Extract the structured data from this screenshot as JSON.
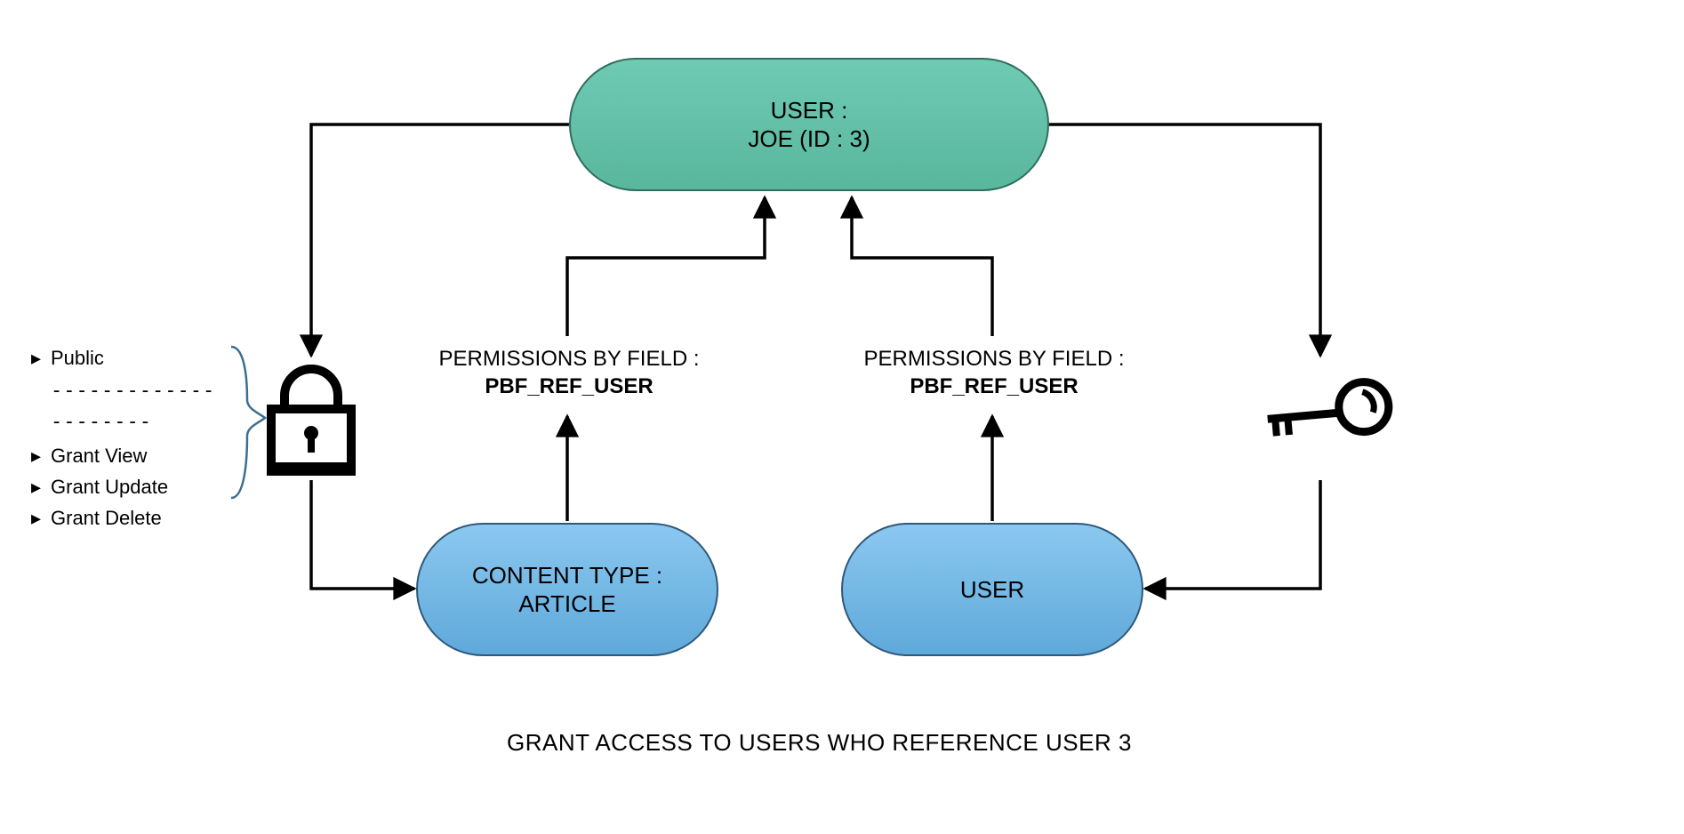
{
  "nodes": {
    "user_top": {
      "line1": "USER :",
      "line2": "JOE (ID : 3)"
    },
    "content_type": {
      "line1": "CONTENT TYPE :",
      "line2": "ARTICLE"
    },
    "user_bottom": {
      "label": "USER"
    }
  },
  "edges": {
    "perm_left": {
      "line1": "PERMISSIONS BY FIELD :",
      "line2": "PBF_REF_USER"
    },
    "perm_right": {
      "line1": "PERMISSIONS BY FIELD :",
      "line2": "PBF_REF_USER"
    }
  },
  "legend": {
    "items_top": [
      "Public"
    ],
    "separator": "---------------------",
    "items_bottom": [
      "Grant View",
      "Grant Update",
      "Grant Delete"
    ]
  },
  "caption": "GRANT ACCESS TO USERS WHO REFERENCE USER 3",
  "icons": {
    "lock": "lock-icon",
    "key": "key-icon"
  }
}
